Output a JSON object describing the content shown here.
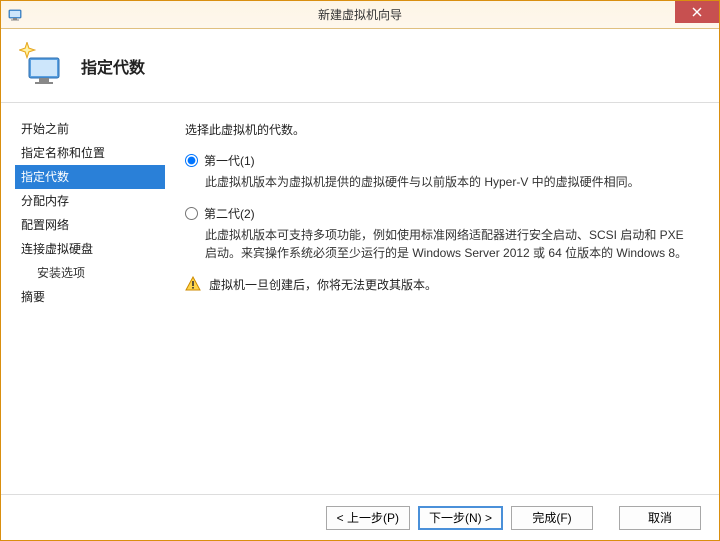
{
  "window": {
    "title": "新建虚拟机向导"
  },
  "header": {
    "heading": "指定代数"
  },
  "nav": {
    "items": [
      "开始之前",
      "指定名称和位置",
      "指定代数",
      "分配内存",
      "配置网络",
      "连接虚拟硬盘",
      "摘要"
    ],
    "subitems": {
      "5": "安装选项"
    },
    "selected_index": 2
  },
  "main": {
    "intro": "选择此虚拟机的代数。",
    "options": [
      {
        "label": "第一代(1)",
        "desc": "此虚拟机版本为虚拟机提供的虚拟硬件与以前版本的 Hyper-V 中的虚拟硬件相同。",
        "checked": true
      },
      {
        "label": "第二代(2)",
        "desc": "此虚拟机版本可支持多项功能，例如使用标准网络适配器进行安全启动、SCSI 启动和 PXE 启动。来宾操作系统必须至少运行的是 Windows Server 2012 或 64 位版本的 Windows 8。",
        "checked": false
      }
    ],
    "warning": "虚拟机一旦创建后，你将无法更改其版本。"
  },
  "footer": {
    "prev": "< 上一步(P)",
    "next": "下一步(N) >",
    "finish": "完成(F)",
    "cancel": "取消"
  }
}
